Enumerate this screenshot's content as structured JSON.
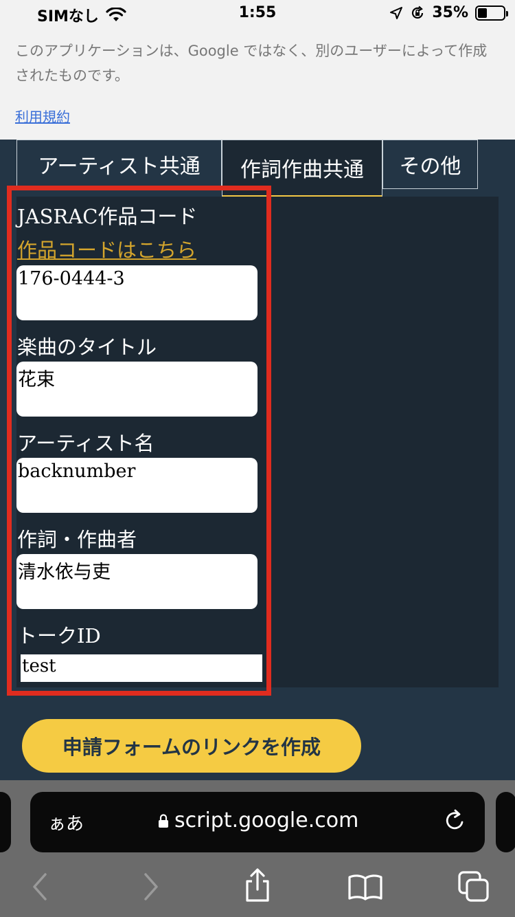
{
  "status": {
    "carrier": "SIMなし",
    "time": "1:55",
    "battery": "35%",
    "battery_level": 0.35
  },
  "notice": {
    "text": "このアプリケーションは、Google ではなく、別のユーザーによって作成されたものです。",
    "terms_link": "利用規約"
  },
  "tabs": [
    {
      "label": "アーティスト共通",
      "active": false
    },
    {
      "label": "作詞作曲共通",
      "active": true
    },
    {
      "label": "その他",
      "active": false
    }
  ],
  "form": {
    "jasrac_label": "JASRAC作品コード",
    "code_link": "作品コードはこちら",
    "jasrac_value": "176-0444-3",
    "title_label": "楽曲のタイトル",
    "title_value": "花束",
    "artist_label": "アーティスト名",
    "artist_value": "backnumber",
    "composer_label": "作詞・作曲者",
    "composer_value": "清水依与吏",
    "talk_id_label": "トークID",
    "talk_id_value": "test"
  },
  "cta_label": "申請フォームのリンクを作成",
  "browser": {
    "aa_label": "ぁあ",
    "url": "script.google.com"
  },
  "icons": [
    "wifi-icon",
    "location-icon",
    "rotation-lock-icon",
    "lock-icon",
    "reload-icon",
    "back-icon",
    "forward-icon",
    "share-icon",
    "bookmarks-icon",
    "tabs-icon"
  ]
}
